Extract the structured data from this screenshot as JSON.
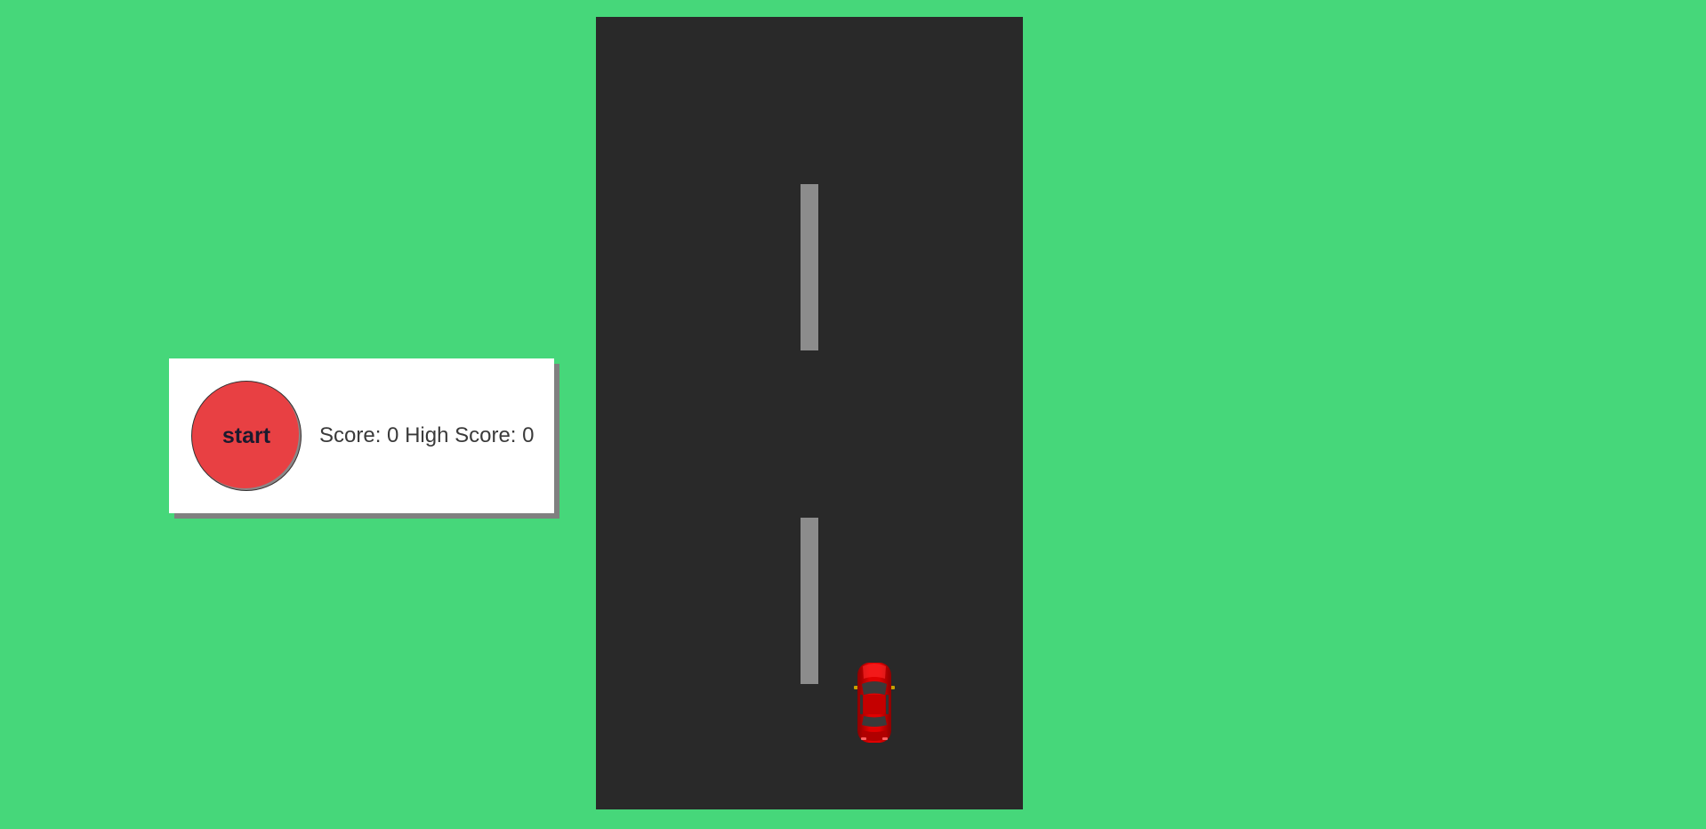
{
  "controls": {
    "start_label": "start"
  },
  "score": {
    "label": "Score:",
    "value": "0",
    "high_label": "High Score:",
    "high_value": "0"
  },
  "colors": {
    "background": "#46d77a",
    "road": "#292929",
    "lane_marking": "#8c8c8c",
    "start_button": "#e84043",
    "player_car": "#d40000"
  },
  "icons": {
    "player": "red-car-icon"
  }
}
